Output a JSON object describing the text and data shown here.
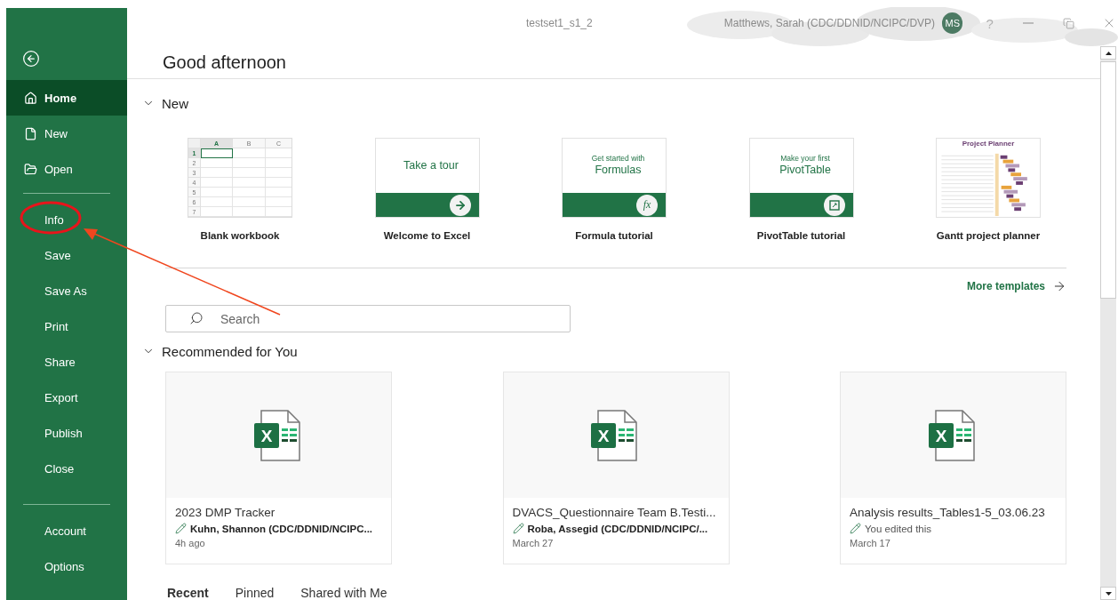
{
  "window": {
    "title": "testset1_s1_2",
    "user": "Matthews, Sarah (CDC/DDNID/NCIPC/DVP)",
    "avatar_initials": "MS",
    "help": "?"
  },
  "sidebar": {
    "items": [
      {
        "label": "Home",
        "selected": true
      },
      {
        "label": "New",
        "selected": false
      },
      {
        "label": "Open",
        "selected": false
      },
      {
        "label": "Info",
        "selected": false
      },
      {
        "label": "Save",
        "selected": false
      },
      {
        "label": "Save As",
        "selected": false
      },
      {
        "label": "Print",
        "selected": false
      },
      {
        "label": "Share",
        "selected": false
      },
      {
        "label": "Export",
        "selected": false
      },
      {
        "label": "Publish",
        "selected": false
      },
      {
        "label": "Close",
        "selected": false
      }
    ],
    "footer_items": [
      {
        "label": "Account",
        "selected": false
      },
      {
        "label": "Options",
        "selected": false
      }
    ]
  },
  "greeting": "Good afternoon",
  "new_section": {
    "title": "New",
    "expanded": true,
    "templates": [
      {
        "kind": "blank",
        "label": "Blank workbook",
        "columns": [
          "A",
          "B",
          "C"
        ],
        "rows": [
          "1",
          "2",
          "3",
          "4",
          "5",
          "6",
          "7"
        ]
      },
      {
        "kind": "banner",
        "label": "Welcome to Excel",
        "heading": "Take a tour",
        "badge": {
          "kind": "arrow"
        }
      },
      {
        "kind": "banner",
        "label": "Formula tutorial",
        "caption": "Get started with",
        "heading": "Formulas",
        "badge": {
          "kind": "text",
          "text": "fx"
        }
      },
      {
        "kind": "banner",
        "label": "PivotTable tutorial",
        "caption": "Make your first",
        "heading": "PivotTable",
        "badge": {
          "kind": "pivot"
        }
      },
      {
        "kind": "gantt",
        "label": "Gantt project planner",
        "sheet_title": "Project Planner"
      }
    ],
    "more_templates": "More templates"
  },
  "search": {
    "placeholder": "Search"
  },
  "recommended": {
    "title": "Recommended for You",
    "expanded": true,
    "files": [
      {
        "name": "2023 DMP Tracker",
        "app_letter": "X",
        "editor": "Kuhn, Shannon (CDC/DDNID/NCIPC...",
        "editor_bold": true,
        "when": "4h ago"
      },
      {
        "name": "DVACS_Questionnaire Team B.Testi...",
        "app_letter": "X",
        "editor": "Roba, Assegid (CDC/DDNID/NCIPC/...",
        "editor_bold": true,
        "when": "March 27"
      },
      {
        "name": "Analysis results_Tables1-5_03.06.23",
        "app_letter": "X",
        "editor": "You edited this",
        "editor_bold": false,
        "when": "March 17"
      }
    ]
  },
  "file_tabs": [
    {
      "label": "Recent",
      "selected": true
    },
    {
      "label": "Pinned",
      "selected": false
    },
    {
      "label": "Shared with Me",
      "selected": false
    }
  ]
}
